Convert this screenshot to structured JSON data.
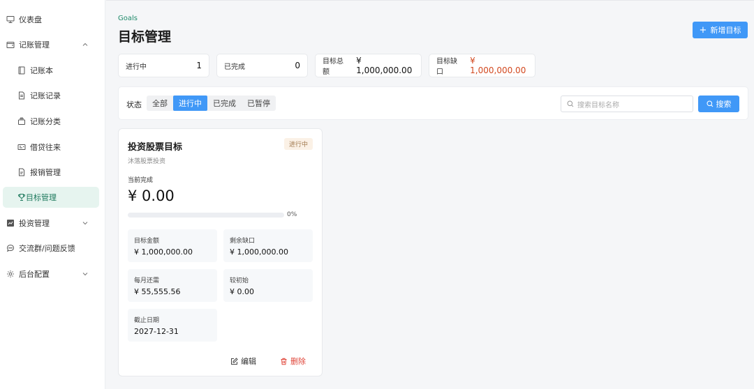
{
  "sidebar": {
    "items": [
      {
        "label": "仪表盘",
        "icon": "dashboard-icon"
      },
      {
        "label": "记账管理",
        "icon": "wallet-icon"
      },
      {
        "label": "记账本",
        "icon": "book-icon"
      },
      {
        "label": "记账记录",
        "icon": "document-icon"
      },
      {
        "label": "记账分类",
        "icon": "category-icon"
      },
      {
        "label": "借贷往来",
        "icon": "loan-icon"
      },
      {
        "label": "报销管理",
        "icon": "receipt-icon"
      },
      {
        "label": "目标管理",
        "icon": "trophy-icon"
      },
      {
        "label": "投资管理",
        "icon": "chart-icon"
      },
      {
        "label": "交流群/问题反馈",
        "icon": "chat-icon"
      },
      {
        "label": "后台配置",
        "icon": "settings-icon"
      }
    ]
  },
  "header": {
    "breadcrumb": "Goals",
    "title": "目标管理",
    "add_button": "新增目标"
  },
  "stats": [
    {
      "label": "进行中",
      "value": "1"
    },
    {
      "label": "已完成",
      "value": "0"
    },
    {
      "label": "目标总额",
      "value": "¥ 1,000,000.00"
    },
    {
      "label": "目标缺口",
      "value": "¥ 1,000,000.00"
    }
  ],
  "filter": {
    "label": "状态",
    "options": [
      "全部",
      "进行中",
      "已完成",
      "已暂停"
    ],
    "selected": "进行中",
    "search_placeholder": "搜索目标名称",
    "search_button": "搜索"
  },
  "goal_card": {
    "title": "投资股票目标",
    "status": "进行中",
    "description": "沐落股票投资",
    "current_label": "当前完成",
    "current_value": "¥ 0.00",
    "progress_percent": 0,
    "progress_text": "0%",
    "fields": [
      {
        "label": "目标金额",
        "value": "¥ 1,000,000.00"
      },
      {
        "label": "剩余缺口",
        "value": "¥ 1,000,000.00"
      },
      {
        "label": "每月还需",
        "value": "¥ 55,555.56"
      },
      {
        "label": "较初始",
        "value": "¥ 0.00"
      },
      {
        "label": "截止日期",
        "value": "2027-12-31"
      }
    ],
    "edit_label": "编辑",
    "delete_label": "删除"
  },
  "colors": {
    "primary": "#4098f7",
    "accent_green": "#1f7a5e",
    "danger": "#e0463a",
    "gap_red": "#d2481f"
  }
}
